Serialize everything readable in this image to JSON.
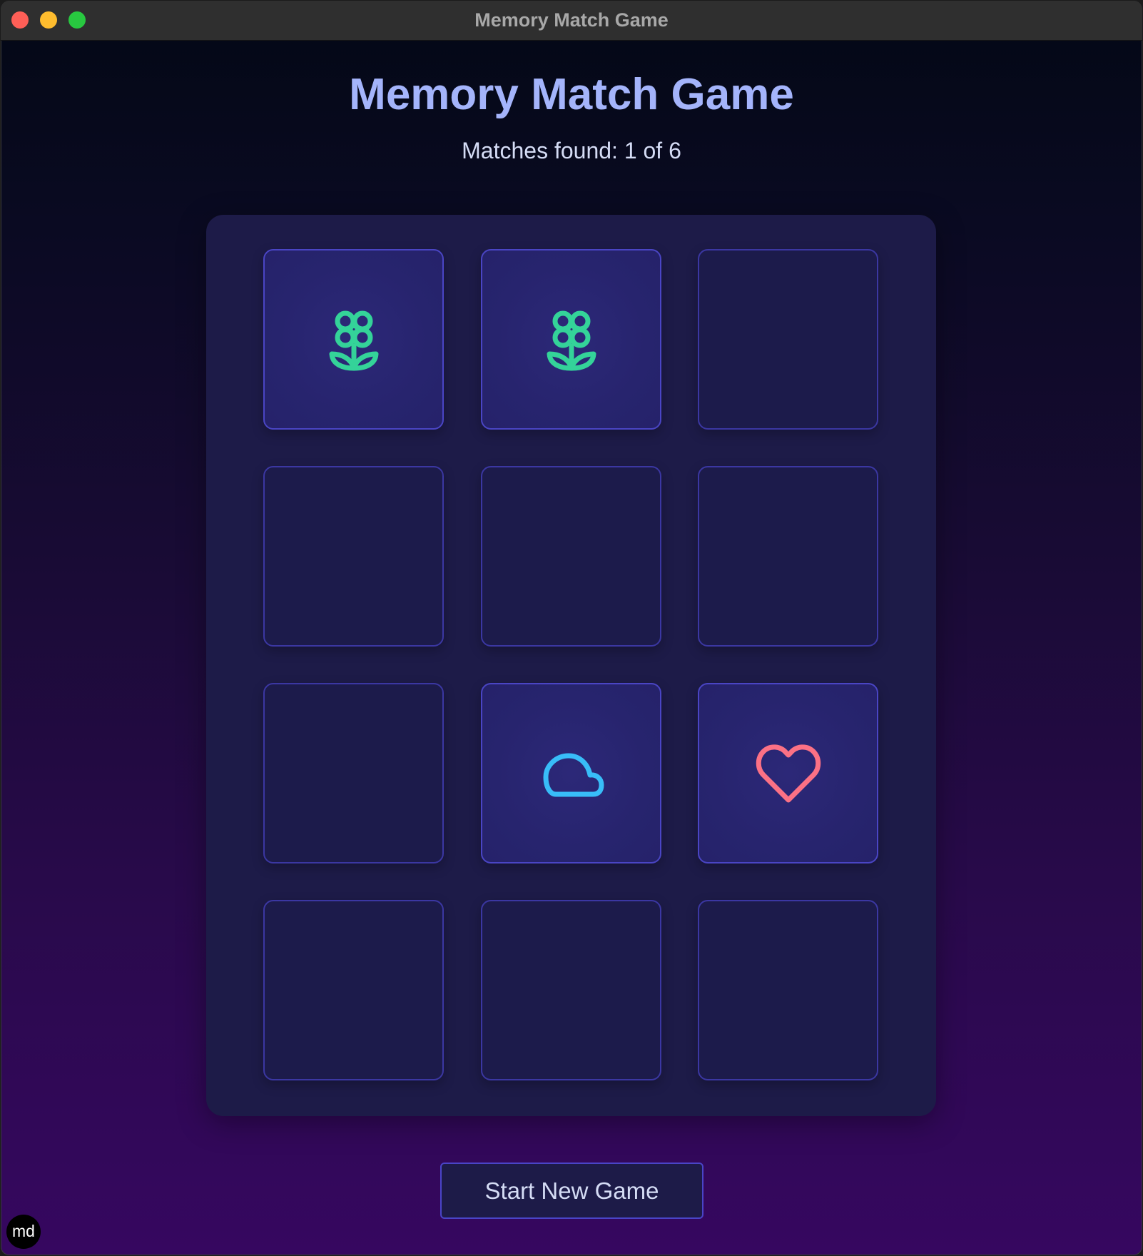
{
  "window": {
    "title": "Memory Match Game"
  },
  "game": {
    "title": "Memory Match Game",
    "status": "Matches found: 1 of 6",
    "matches_found": 1,
    "total_matches": 6
  },
  "cards": [
    {
      "row": 1,
      "col": 1,
      "revealed": true,
      "icon": "flower-icon",
      "color": "#34d399"
    },
    {
      "row": 1,
      "col": 2,
      "revealed": true,
      "icon": "flower-icon",
      "color": "#34d399"
    },
    {
      "row": 1,
      "col": 3,
      "revealed": false,
      "icon": null
    },
    {
      "row": 2,
      "col": 1,
      "revealed": false,
      "icon": null
    },
    {
      "row": 2,
      "col": 2,
      "revealed": false,
      "icon": null
    },
    {
      "row": 2,
      "col": 3,
      "revealed": false,
      "icon": null
    },
    {
      "row": 3,
      "col": 1,
      "revealed": false,
      "icon": null
    },
    {
      "row": 3,
      "col": 2,
      "revealed": true,
      "icon": "cloud-icon",
      "color": "#38bdf8"
    },
    {
      "row": 3,
      "col": 3,
      "revealed": true,
      "icon": "heart-icon",
      "color": "#fb7185"
    },
    {
      "row": 4,
      "col": 1,
      "revealed": false,
      "icon": null
    },
    {
      "row": 4,
      "col": 2,
      "revealed": false,
      "icon": null
    },
    {
      "row": 4,
      "col": 3,
      "revealed": false,
      "icon": null
    }
  ],
  "controls": {
    "new_game_label": "Start New Game"
  },
  "badge": {
    "label": "md"
  },
  "colors": {
    "title": "#a4b4fb",
    "card_border": "#3b37a2",
    "board_bg": "#1d1b48",
    "flower": "#34d399",
    "cloud": "#38bdf8",
    "heart": "#fb7185"
  }
}
